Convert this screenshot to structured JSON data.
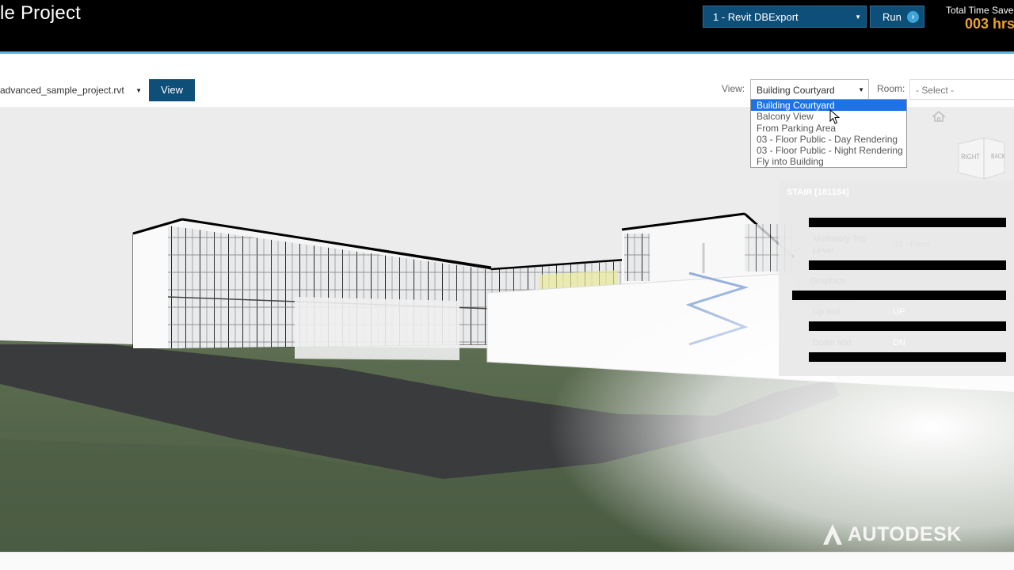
{
  "header": {
    "title": "le Project",
    "workflow_select": "1 - Revit DBExport",
    "run_label": "Run",
    "time_saved_label": "Total Time Saved",
    "time_saved_value": "003 hrs"
  },
  "toolbar": {
    "file_select": "advanced_sample_project.rvt",
    "view_button": "View",
    "view_label": "View:",
    "view_selected": "Building Courtyard",
    "room_label": "Room:",
    "room_selected": "- Select -"
  },
  "view_dropdown": {
    "options": [
      "Building Courtyard",
      "Balcony View",
      "From Parking Area",
      "03 - Floor Public - Day Rendering",
      "03 - Floor Public - Night Rendering",
      "Fly into Building"
    ],
    "selected_index": 0
  },
  "viewer": {
    "view_cube": {
      "right": "RIGHT",
      "back": "BACK"
    },
    "properties": {
      "title": "STAIR [181184]",
      "rows": [
        {
          "label": "Multistory Top Level",
          "value": "03 - Floor"
        },
        {
          "label": "Graphics",
          "value": ""
        },
        {
          "label": "Up text",
          "value": "UP"
        },
        {
          "label": "Down text",
          "value": "DN"
        }
      ]
    },
    "watermark": "AUTODESK"
  },
  "colors": {
    "header_bg": "#000000",
    "accent_blue": "#0e4f7a",
    "accent_line": "#5ab8d8",
    "time_orange": "#e8a42c",
    "selection": "#1e72e8"
  }
}
